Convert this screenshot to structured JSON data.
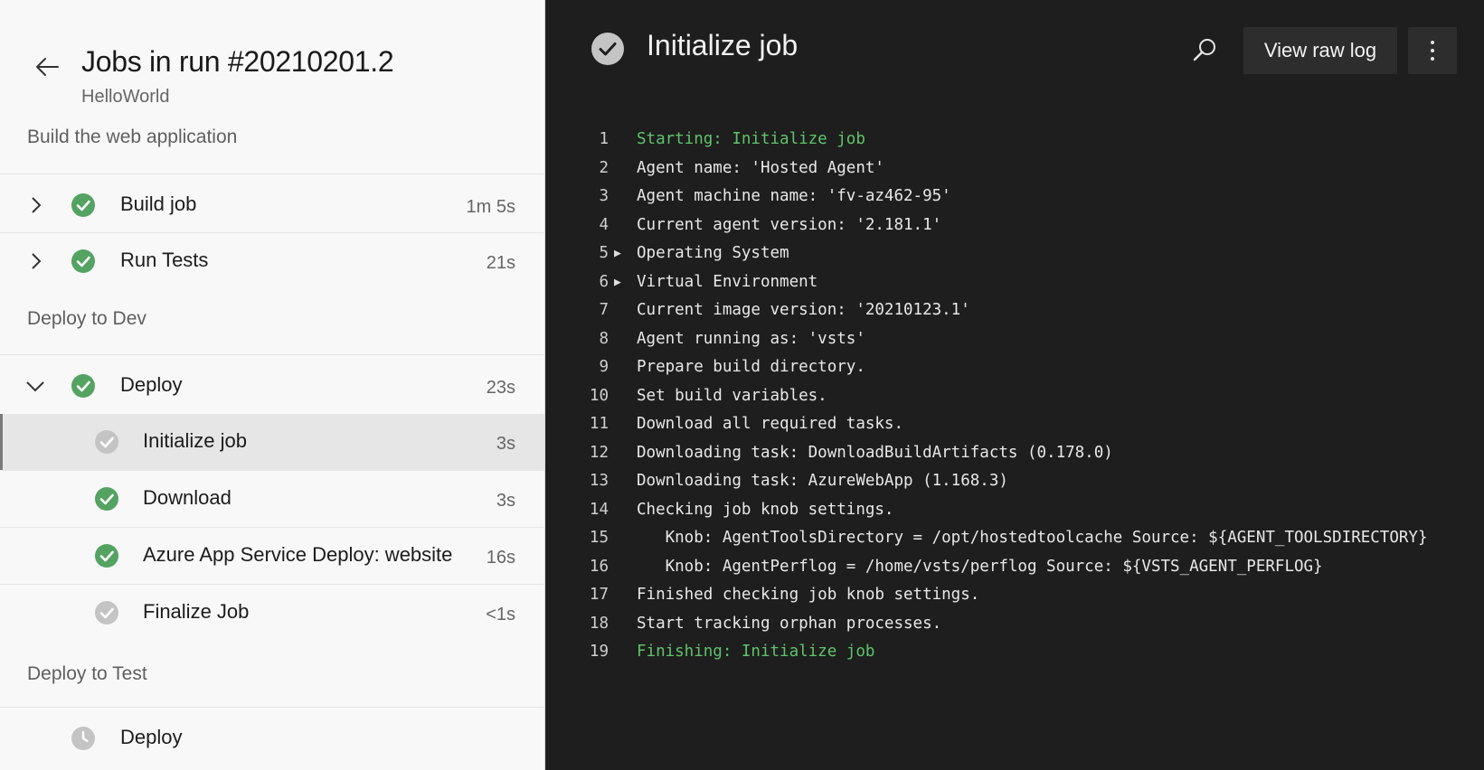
{
  "header": {
    "title": "Jobs in run #20210201.2",
    "subtitle": "HelloWorld"
  },
  "stages": [
    {
      "name": "Build the web application"
    },
    {
      "name": "Deploy to Dev"
    },
    {
      "name": "Deploy to Test"
    }
  ],
  "jobs": [
    {
      "label": "Build job",
      "duration": "1m 5s",
      "status": "success"
    },
    {
      "label": "Run Tests",
      "duration": "21s",
      "status": "success"
    },
    {
      "label": "Deploy",
      "duration": "23s",
      "status": "success"
    },
    {
      "label": "Deploy",
      "duration": "",
      "status": "pending"
    }
  ],
  "steps": [
    {
      "label": "Initialize job",
      "duration": "3s",
      "status": "done-gray"
    },
    {
      "label": "Download",
      "duration": "3s",
      "status": "success"
    },
    {
      "label": "Azure App Service Deploy: website",
      "duration": "16s",
      "status": "success"
    },
    {
      "label": "Finalize Job",
      "duration": "<1s",
      "status": "done-gray"
    }
  ],
  "log_panel": {
    "title": "Initialize job",
    "view_raw_label": "View raw log",
    "lines": [
      {
        "num": "1",
        "text": "Starting: Initialize job"
      },
      {
        "num": "2",
        "text": "Agent name: 'Hosted Agent'"
      },
      {
        "num": "3",
        "text": "Agent machine name: 'fv-az462-95'"
      },
      {
        "num": "4",
        "text": "Current agent version: '2.181.1'"
      },
      {
        "num": "5",
        "text": "Operating System"
      },
      {
        "num": "6",
        "text": "Virtual Environment"
      },
      {
        "num": "7",
        "text": "Current image version: '20210123.1'"
      },
      {
        "num": "8",
        "text": "Agent running as: 'vsts'"
      },
      {
        "num": "9",
        "text": "Prepare build directory."
      },
      {
        "num": "10",
        "text": "Set build variables."
      },
      {
        "num": "11",
        "text": "Download all required tasks."
      },
      {
        "num": "12",
        "text": "Downloading task: DownloadBuildArtifacts (0.178.0)"
      },
      {
        "num": "13",
        "text": "Downloading task: AzureWebApp (1.168.3)"
      },
      {
        "num": "14",
        "text": "Checking job knob settings."
      },
      {
        "num": "15",
        "text": "   Knob: AgentToolsDirectory = /opt/hostedtoolcache Source: ${AGENT_TOOLSDIRECTORY}"
      },
      {
        "num": "16",
        "text": "   Knob: AgentPerflog = /home/vsts/perflog Source: ${VSTS_AGENT_PERFLOG}"
      },
      {
        "num": "17",
        "text": "Finished checking job knob settings."
      },
      {
        "num": "18",
        "text": "Start tracking orphan processes."
      },
      {
        "num": "19",
        "text": "Finishing: Initialize job"
      }
    ]
  },
  "colors": {
    "success": "#55a362",
    "done_gray": "#c4c4c4",
    "log_green": "#5fc36a",
    "log_bg": "#1e1e1e",
    "panel_bg": "#f8f8f8"
  },
  "icons": {
    "back": "arrow-left-icon",
    "expand": "chevron-right-icon",
    "collapse": "chevron-down-icon",
    "success": "check-circle-icon",
    "pending": "clock-icon",
    "search": "search-icon",
    "more": "more-vertical-icon",
    "log_expand": "triangle-right-icon"
  }
}
